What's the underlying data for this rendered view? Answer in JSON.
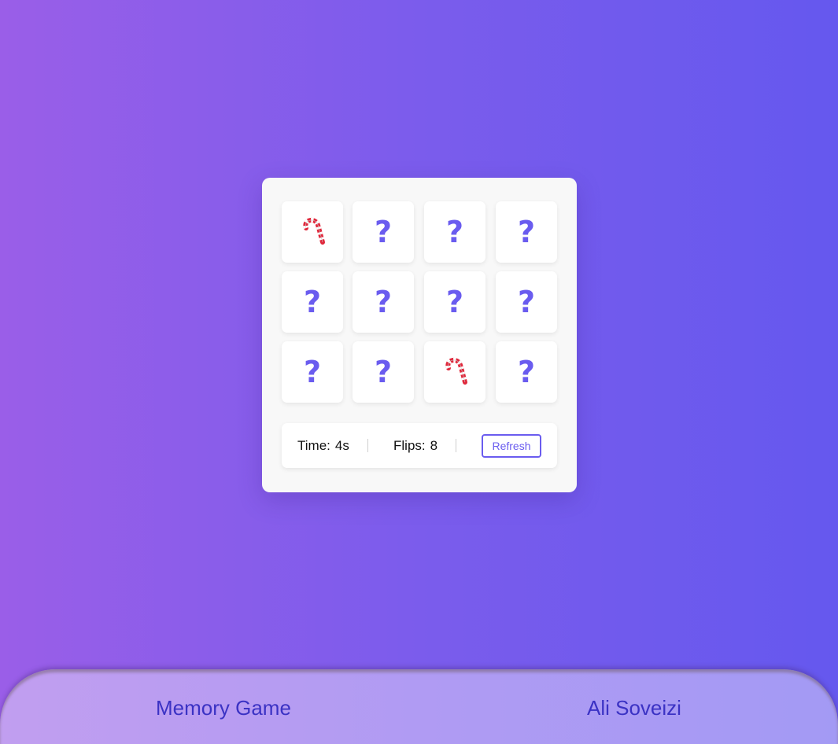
{
  "cards": [
    {
      "state": "revealed",
      "icon": "candy-cane-icon"
    },
    {
      "state": "hidden",
      "symbol": "?"
    },
    {
      "state": "hidden",
      "symbol": "?"
    },
    {
      "state": "hidden",
      "symbol": "?"
    },
    {
      "state": "hidden",
      "symbol": "?"
    },
    {
      "state": "hidden",
      "symbol": "?"
    },
    {
      "state": "hidden",
      "symbol": "?"
    },
    {
      "state": "hidden",
      "symbol": "?"
    },
    {
      "state": "hidden",
      "symbol": "?"
    },
    {
      "state": "hidden",
      "symbol": "?"
    },
    {
      "state": "revealed",
      "icon": "candy-cane-icon"
    },
    {
      "state": "hidden",
      "symbol": "?"
    }
  ],
  "details": {
    "time_label": "Time:",
    "time_value": "4s",
    "flips_label": "Flips:",
    "flips_value": "8",
    "refresh_label": "Refresh"
  },
  "footer": {
    "title": "Memory Game",
    "author": "Ali Soveizi"
  },
  "colors": {
    "accent": "#6a5cef",
    "footer_text": "#3b32c4",
    "background_start": "#9a5ee8",
    "background_end": "#6558ee"
  }
}
